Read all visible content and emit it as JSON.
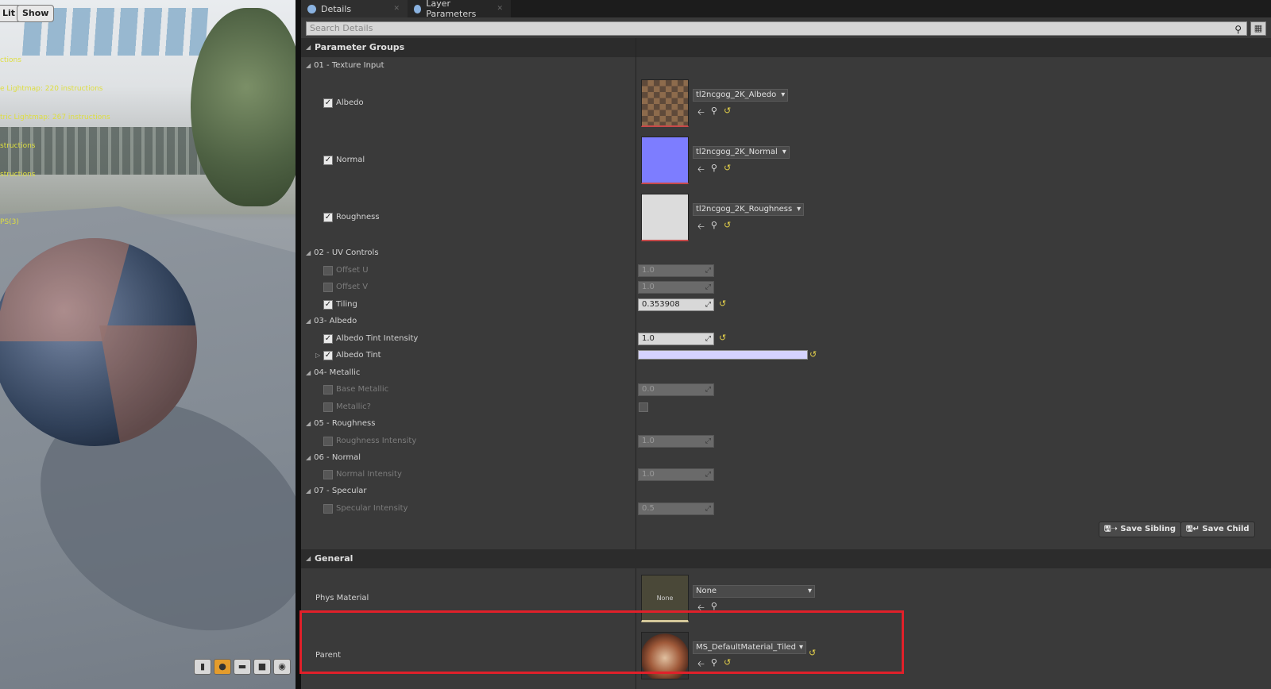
{
  "viewport": {
    "buttons": [
      "Lit",
      "Show"
    ],
    "stats": [
      "ctions",
      "e Lightmap: 220 instructions",
      "tric Lightmap: 267 instructions",
      "structions",
      "structions",
      "",
      "PS(3)"
    ],
    "toolbar_icons": [
      "perspective-icon",
      "sphere-preview-icon",
      "plane-preview-icon",
      "cube-preview-icon",
      "cylinder-preview-icon"
    ]
  },
  "tabs": [
    {
      "label": "Details",
      "icon": "info-icon"
    },
    {
      "label": "Layer Parameters",
      "icon": "info-icon"
    }
  ],
  "search": {
    "placeholder": "Search Details"
  },
  "parameter_groups": {
    "title": "Parameter Groups",
    "groups": [
      {
        "name": "01 - Texture Input"
      },
      {
        "name": "02 - UV Controls"
      },
      {
        "name": "03- Albedo"
      },
      {
        "name": "04- Metallic"
      },
      {
        "name": "05 - Roughness"
      },
      {
        "name": "06 - Normal"
      },
      {
        "name": "07 - Specular"
      }
    ],
    "textures": [
      {
        "label": "Albedo",
        "asset": "tl2ncgog_2K_Albedo",
        "checked": true
      },
      {
        "label": "Normal",
        "asset": "tl2ncgog_2K_Normal",
        "checked": true
      },
      {
        "label": "Roughness",
        "asset": "tl2ncgog_2K_Roughness",
        "checked": true
      }
    ],
    "params": {
      "offset_u": {
        "label": "Offset U",
        "value": "1.0"
      },
      "offset_v": {
        "label": "Offset V",
        "value": "1.0"
      },
      "tiling": {
        "label": "Tiling",
        "value": "0.353908"
      },
      "albedo_tint_intensity": {
        "label": "Albedo Tint Intensity",
        "value": "1.0"
      },
      "albedo_tint": {
        "label": "Albedo Tint",
        "color": "#d5d3ff"
      },
      "base_metallic": {
        "label": "Base Metallic",
        "value": "0.0"
      },
      "metallic": {
        "label": "Metallic?"
      },
      "roughness_intensity": {
        "label": "Roughness Intensity",
        "value": "1.0"
      },
      "normal_intensity": {
        "label": "Normal Intensity",
        "value": "1.0"
      },
      "specular_intensity": {
        "label": "Specular Intensity",
        "value": "0.5"
      }
    },
    "save_sibling": "Save Sibling",
    "save_child": "Save Child"
  },
  "general": {
    "title": "General",
    "phys_material": {
      "label": "Phys Material",
      "thumb_text": "None",
      "value": "None"
    },
    "parent": {
      "label": "Parent",
      "value": "MS_DefaultMaterial_Tiled"
    }
  },
  "colors": {
    "highlight": "#e0202a",
    "reset_arrow": "#e2cf4a"
  }
}
